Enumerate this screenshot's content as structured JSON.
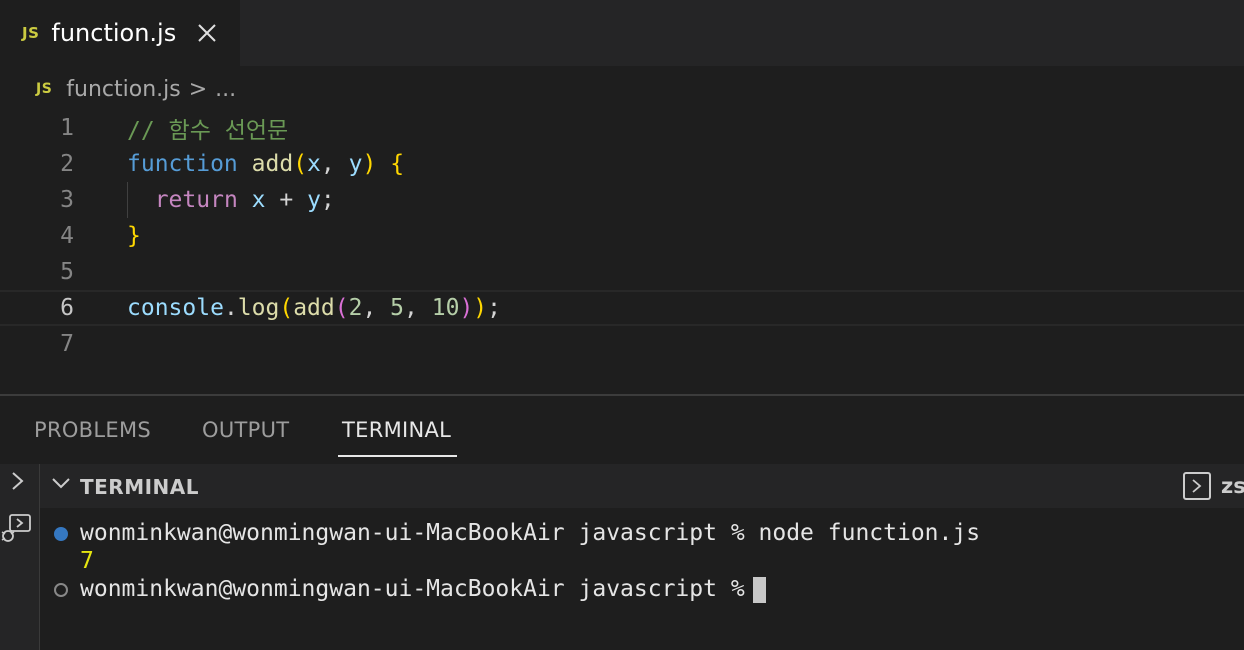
{
  "tab": {
    "badge": "JS",
    "title": "function.js"
  },
  "breadcrumb": {
    "badge": "JS",
    "file": "function.js",
    "separator": ">",
    "more": "..."
  },
  "code_lines": [
    {
      "num": "1",
      "tokens": [
        [
          "c-comment",
          "// 함수 선언문"
        ]
      ]
    },
    {
      "num": "2",
      "tokens": [
        [
          "c-kw",
          "function"
        ],
        [
          "c-op",
          " "
        ],
        [
          "c-fn",
          "add"
        ],
        [
          "c-brace",
          "("
        ],
        [
          "c-var",
          "x"
        ],
        [
          "c-op",
          ", "
        ],
        [
          "c-var",
          "y"
        ],
        [
          "c-brace",
          ")"
        ],
        [
          "c-op",
          " "
        ],
        [
          "c-brace",
          "{"
        ]
      ]
    },
    {
      "num": "3",
      "tokens": [
        [
          "c-op",
          "  "
        ],
        [
          "c-ret",
          "return"
        ],
        [
          "c-op",
          " "
        ],
        [
          "c-var",
          "x"
        ],
        [
          "c-op",
          " + "
        ],
        [
          "c-var",
          "y"
        ],
        [
          "c-op",
          ";"
        ]
      ]
    },
    {
      "num": "4",
      "tokens": [
        [
          "c-brace",
          "}"
        ]
      ]
    },
    {
      "num": "5",
      "tokens": []
    },
    {
      "num": "6",
      "tokens": [
        [
          "c-var",
          "console"
        ],
        [
          "c-op",
          "."
        ],
        [
          "c-fn",
          "log"
        ],
        [
          "c-brace",
          "("
        ],
        [
          "c-fn",
          "add"
        ],
        [
          "c-brace2",
          "("
        ],
        [
          "c-num",
          "2"
        ],
        [
          "c-op",
          ", "
        ],
        [
          "c-num",
          "5"
        ],
        [
          "c-op",
          ", "
        ],
        [
          "c-num",
          "10"
        ],
        [
          "c-brace2",
          ")"
        ],
        [
          "c-brace",
          ")"
        ],
        [
          "c-op",
          ";"
        ]
      ]
    },
    {
      "num": "7",
      "tokens": []
    }
  ],
  "panel": {
    "tabs": {
      "problems": "PROBLEMS",
      "output": "OUTPUT",
      "terminal": "TERMINAL"
    }
  },
  "terminal": {
    "header_title": "TERMINAL",
    "shell_name": "zs",
    "line1": "wonminkwan@wonmingwan-ui-MacBookAir javascript % node function.js",
    "output": "7",
    "prompt": "wonminkwan@wonmingwan-ui-MacBookAir javascript %"
  },
  "colors": {
    "editor_bg": "#1e1e1e",
    "keyword": "#569cd6",
    "function": "#dcdcaa",
    "variable": "#9cdcfe",
    "comment": "#6a9955",
    "number": "#b5cea8",
    "bracket_gold": "#ffd700",
    "bracket_violet": "#da70d6",
    "return_keyword": "#c586c0"
  },
  "icons": {
    "tab_close": "close-icon",
    "panel_toggle": "chevron-right-icon",
    "run_debug": "debug-console-icon",
    "terminal_collapse": "chevron-down-icon",
    "shell": "terminal-shell-icon"
  }
}
